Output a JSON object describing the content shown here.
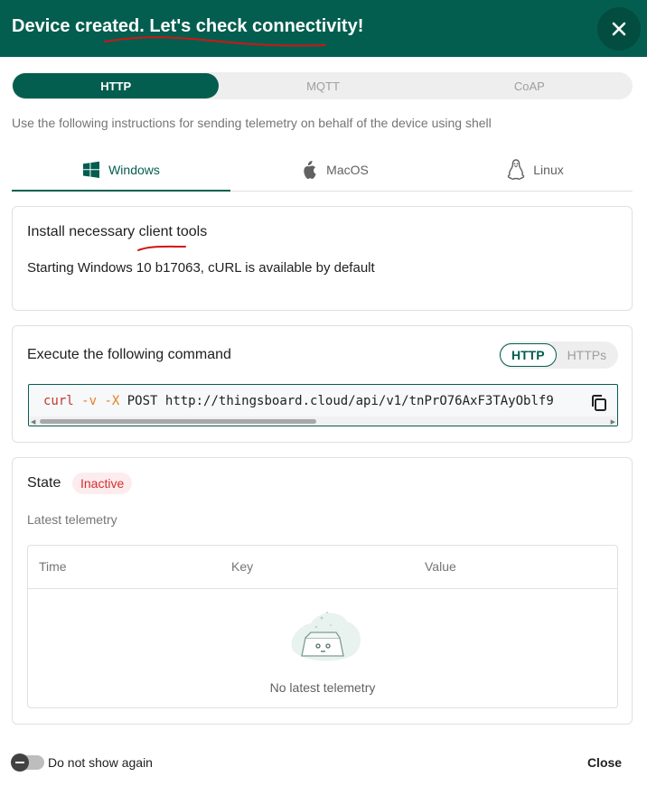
{
  "header": {
    "title": "Device created. Let's check connectivity!",
    "background": "#045e4f"
  },
  "protocol_tabs": [
    {
      "label": "HTTP",
      "active": true
    },
    {
      "label": "MQTT",
      "active": false
    },
    {
      "label": "CoAP",
      "active": false
    }
  ],
  "instructions": "Use the following instructions for sending telemetry on behalf of the device using shell",
  "os_tabs": [
    {
      "label": "Windows",
      "icon": "windows-icon",
      "active": true
    },
    {
      "label": "MacOS",
      "icon": "apple-icon",
      "active": false
    },
    {
      "label": "Linux",
      "icon": "linux-icon",
      "active": false
    }
  ],
  "install_card": {
    "title": "Install necessary client tools",
    "text": "Starting Windows 10 b17063, cURL is available by default"
  },
  "command_card": {
    "title": "Execute the following command",
    "scheme_options": [
      {
        "label": "HTTP",
        "active": true
      },
      {
        "label": "HTTPs",
        "active": false
      }
    ],
    "command": {
      "cmd": "curl",
      "flag1": "-v",
      "flag2": "-X",
      "rest": "POST http://thingsboard.cloud/api/v1/tnPrO76AxF3TAyOblf9"
    }
  },
  "state_card": {
    "title": "State",
    "status": "Inactive",
    "subtitle": "Latest telemetry",
    "columns": [
      "Time",
      "Key",
      "Value"
    ],
    "empty_text": "No latest telemetry"
  },
  "footer": {
    "toggle_label": "Do not show again",
    "close_label": "Close"
  },
  "colors": {
    "accent": "#045e4f",
    "inactive": "#d32f2f"
  }
}
